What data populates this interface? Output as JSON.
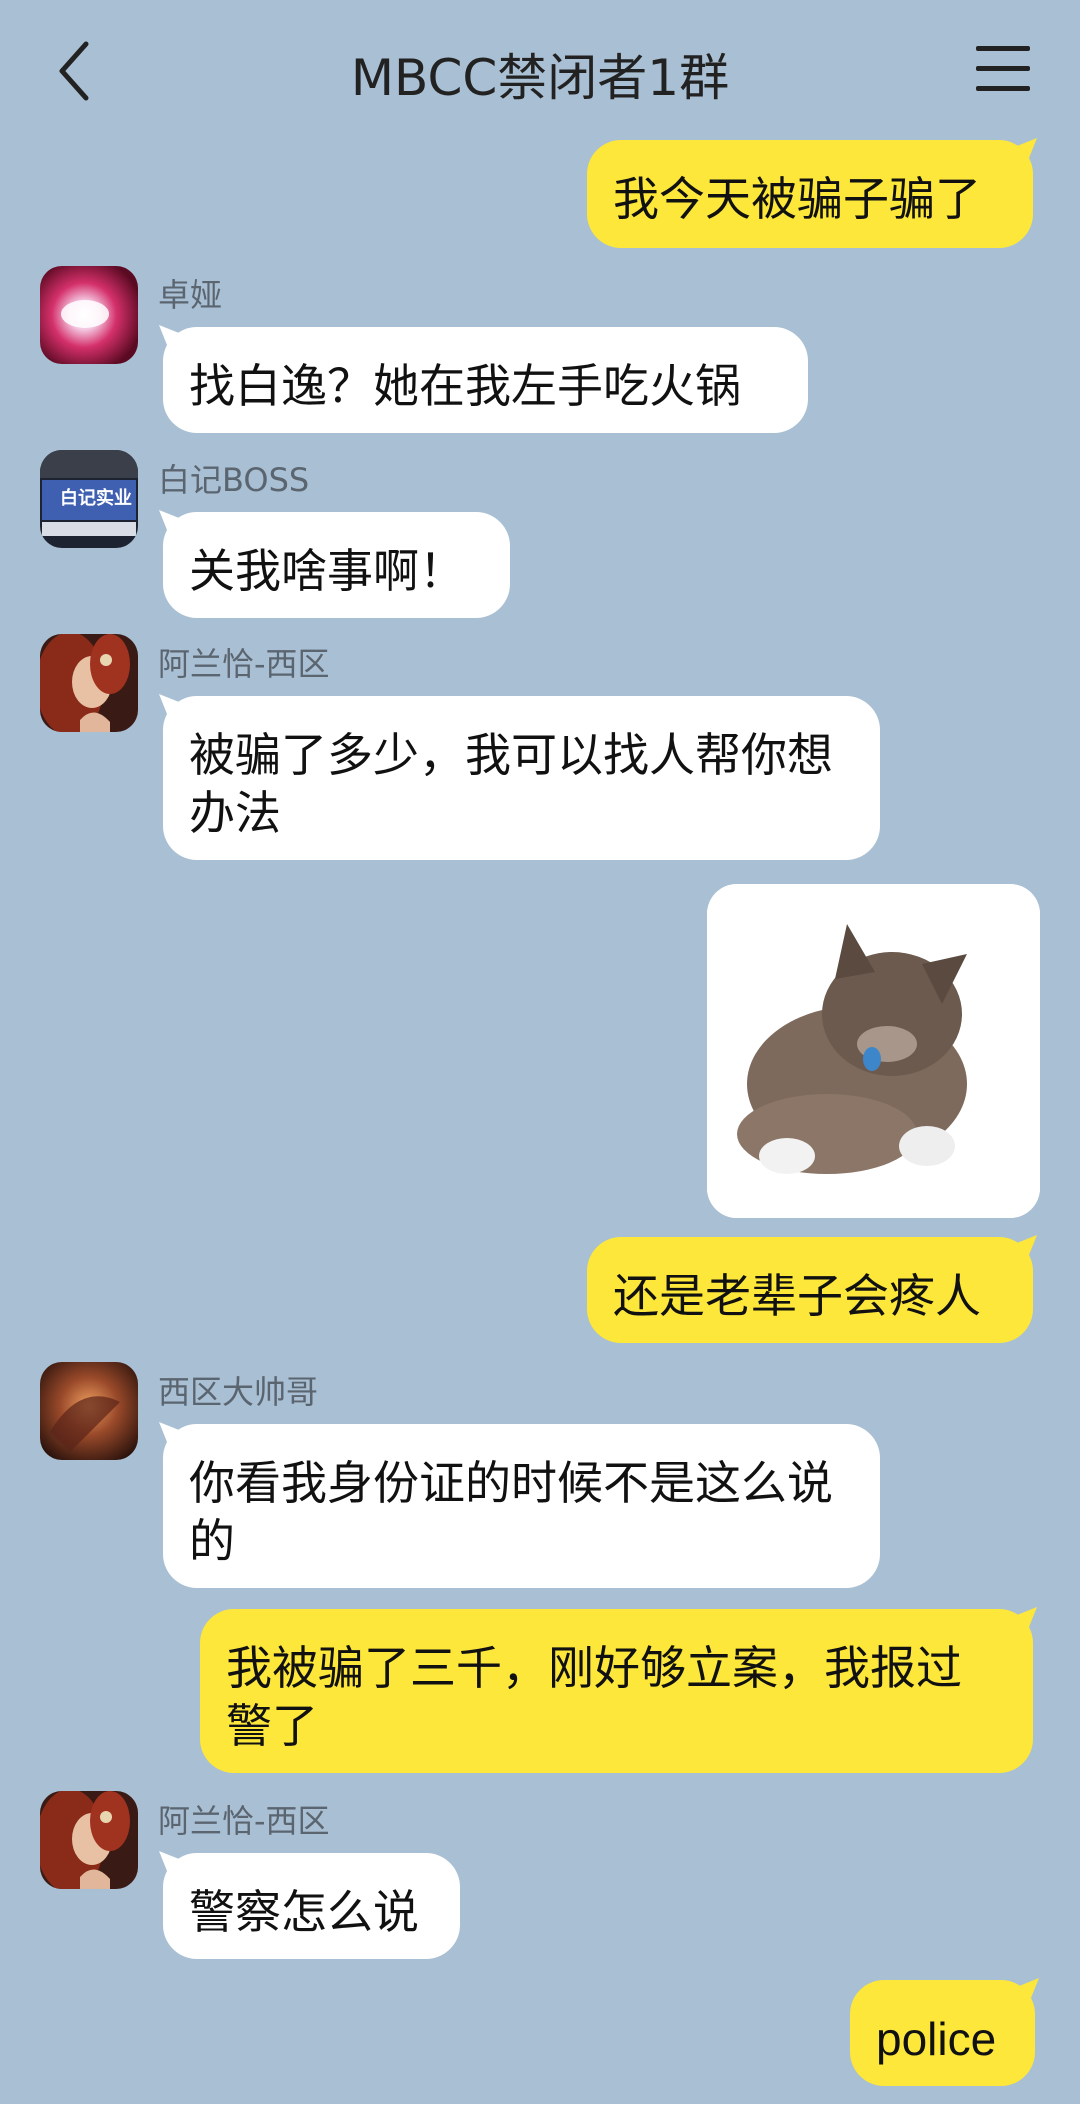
{
  "header": {
    "title": "MBCC禁闭者1群"
  },
  "messages": [
    {
      "side": "right",
      "text": "我今天被骗子骗了"
    },
    {
      "side": "left",
      "sender": "卓娅",
      "avatar": "avatar-zhuoya",
      "text": "找白逸？她在我左手吃火锅"
    },
    {
      "side": "left",
      "sender": "白记BOSS",
      "avatar": "avatar-baiji-boss",
      "avatar_text": "白记实业",
      "text": "关我啥事啊！"
    },
    {
      "side": "left",
      "sender": "阿兰恰-西区",
      "avatar": "avatar-alancha",
      "text": "被骗了多少，我可以找人帮你想办法"
    },
    {
      "side": "right",
      "type": "sticker",
      "sticker": "crying-kitten-sticker"
    },
    {
      "side": "right",
      "text": "还是老辈子会疼人"
    },
    {
      "side": "left",
      "sender": "西区大帅哥",
      "avatar": "avatar-xiqu-dashuaige",
      "text": "你看我身份证的时候不是这么说的"
    },
    {
      "side": "right",
      "text": "我被骗了三千，刚好够立案，我报过警了"
    },
    {
      "side": "left",
      "sender": "阿兰恰-西区",
      "avatar": "avatar-alancha",
      "text": "警察怎么说"
    },
    {
      "side": "right",
      "text": "police"
    }
  ],
  "colors": {
    "background": "#a9bfd3",
    "self_bubble": "#fde73a",
    "other_bubble": "#ffffff"
  }
}
